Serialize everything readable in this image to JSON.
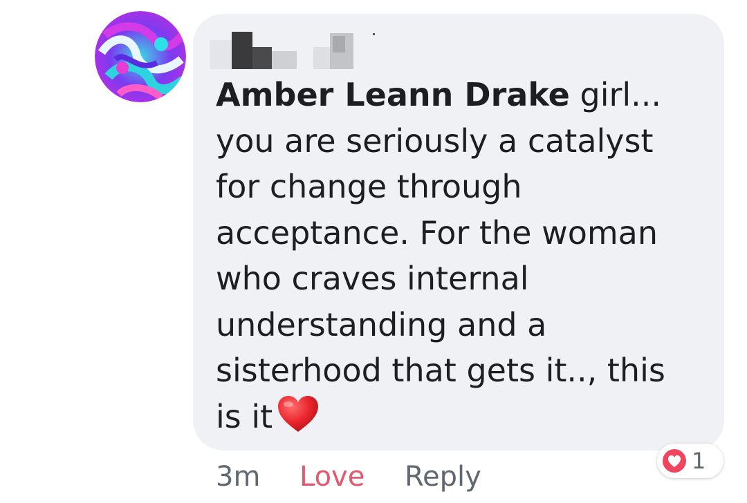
{
  "comment": {
    "author_name": "Amber Leann Drake",
    "lines": [
      " girl...",
      "you are seriously a catalyst",
      "for change through",
      "acceptance. For the woman",
      "who craves internal",
      "understanding and a",
      "sisterhood that gets it.., this",
      "is it"
    ],
    "emoji": "heart-emoji"
  },
  "actions": {
    "time": "3m",
    "love_label": "Love",
    "reply_label": "Reply"
  },
  "reactions": {
    "icon": "love-reaction-icon",
    "count": "1"
  },
  "colors": {
    "bubble": "#f0f1f5",
    "text": "#1c1e21",
    "meta": "#606770",
    "love": "#e4576c",
    "reaction": "#f0455e"
  }
}
